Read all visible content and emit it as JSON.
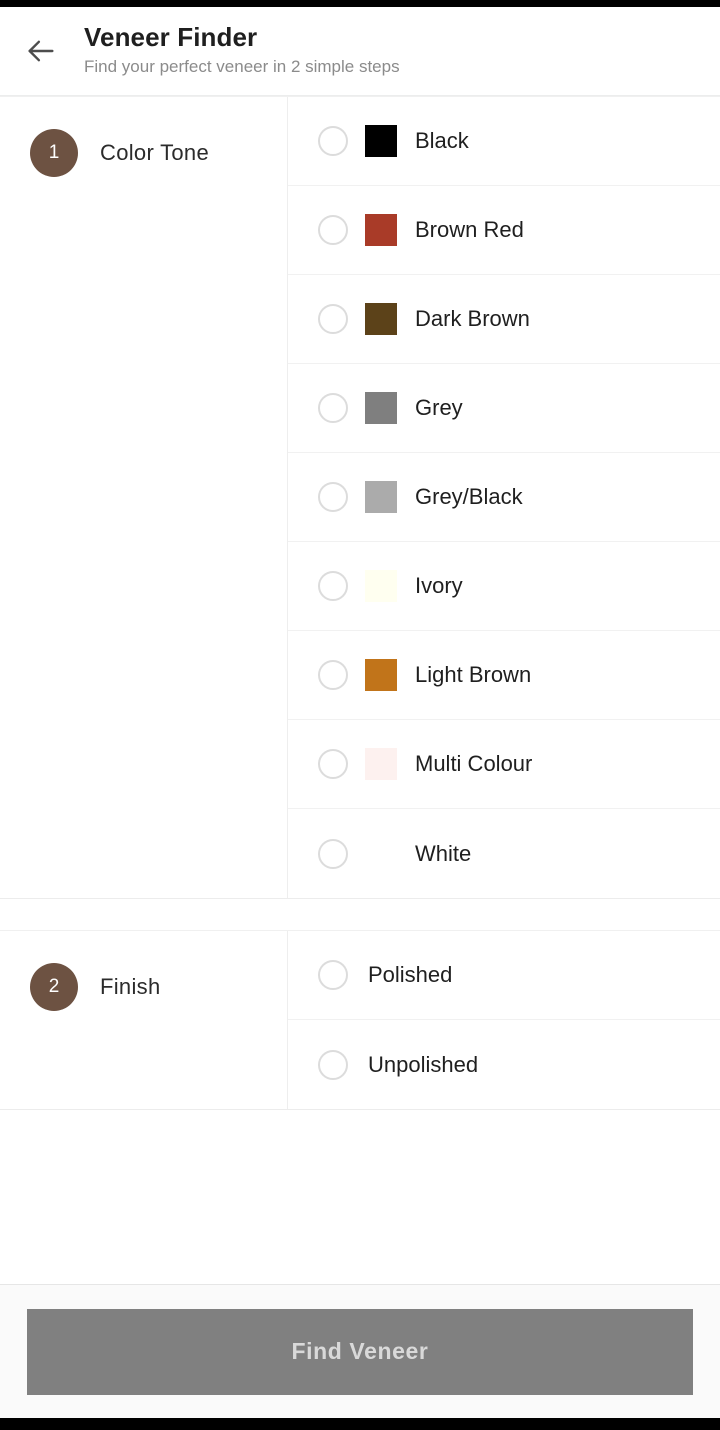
{
  "header": {
    "back_icon": "arrow-left-icon",
    "title": "Veneer Finder",
    "subtitle": "Find your perfect veneer in 2 simple steps"
  },
  "steps": [
    {
      "number": "1",
      "title": "Color Tone",
      "options": [
        {
          "label": "Black",
          "swatch": "#000000",
          "selected": false
        },
        {
          "label": "Brown Red",
          "swatch": "#a93b28",
          "selected": false
        },
        {
          "label": "Dark Brown",
          "swatch": "#5c4219",
          "selected": false
        },
        {
          "label": "Grey",
          "swatch": "#7f7f7f",
          "selected": false
        },
        {
          "label": "Grey/Black",
          "swatch": "#ababab",
          "selected": false
        },
        {
          "label": "Ivory",
          "swatch": "#fffff0",
          "selected": false
        },
        {
          "label": "Light Brown",
          "swatch": "#c1741a",
          "selected": false
        },
        {
          "label": "Multi Colour",
          "swatch": "#fdf1ef",
          "selected": false
        },
        {
          "label": "White",
          "swatch": "",
          "selected": false
        }
      ]
    },
    {
      "number": "2",
      "title": "Finish",
      "options": [
        {
          "label": "Polished",
          "swatch": null,
          "selected": false
        },
        {
          "label": "Unpolished",
          "swatch": null,
          "selected": false
        }
      ]
    }
  ],
  "footer": {
    "submit_label": "Find Veneer",
    "submit_enabled": false
  },
  "colors": {
    "accent": "#6d5242",
    "page_bg": "#ffffff",
    "footer_bg": "#fafafa",
    "disabled_button": "#808080",
    "disabled_button_text": "#d9d9d9",
    "divider": "#f1f1f1",
    "radio_border": "#dcdcdc",
    "title_text": "#1f1f1f",
    "subtitle_text": "#8b8b8b"
  }
}
